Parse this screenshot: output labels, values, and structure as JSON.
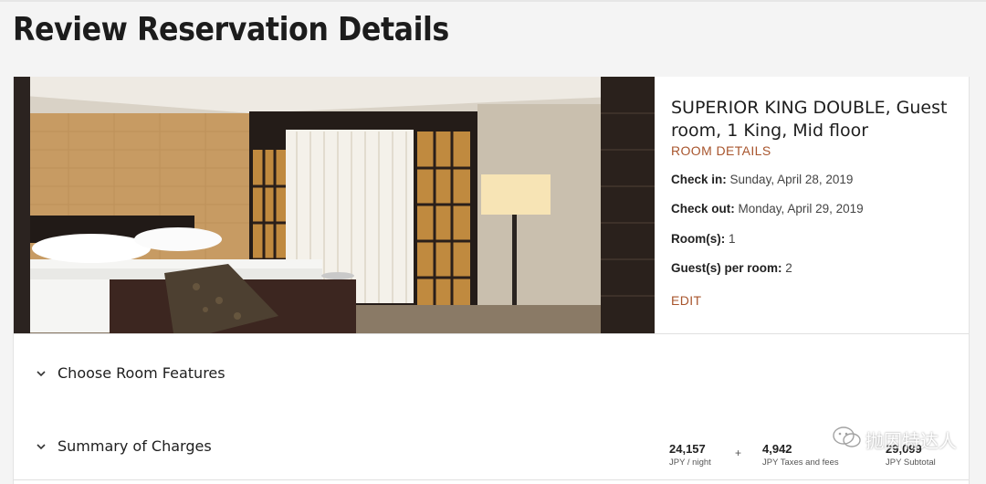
{
  "page": {
    "title": "Review Reservation Details"
  },
  "room": {
    "name": "SUPERIOR KING DOUBLE, Guest room, 1 King, Mid floor",
    "details_link": "ROOM DETAILS",
    "check_in_label": "Check in:",
    "check_in_value": "Sunday, April 28, 2019",
    "check_out_label": "Check out:",
    "check_out_value": "Monday, April 29, 2019",
    "rooms_label": "Room(s):",
    "rooms_value": "1",
    "guests_label": "Guest(s) per room:",
    "guests_value": "2",
    "edit_label": "EDIT"
  },
  "sections": {
    "room_features": "Choose Room Features",
    "summary_of_charges": "Summary of Charges"
  },
  "charges": {
    "per_night_amount": "24,157",
    "per_night_unit": "JPY / night",
    "plus_sign": "+",
    "taxes_amount": "4,942",
    "taxes_unit": "JPY Taxes and fees",
    "subtotal_amount": "29,099",
    "subtotal_unit": "JPY Subtotal"
  },
  "watermark": {
    "text": "抛因特达人"
  },
  "colors": {
    "accent": "#a8552d",
    "background": "#f4f4f4"
  }
}
